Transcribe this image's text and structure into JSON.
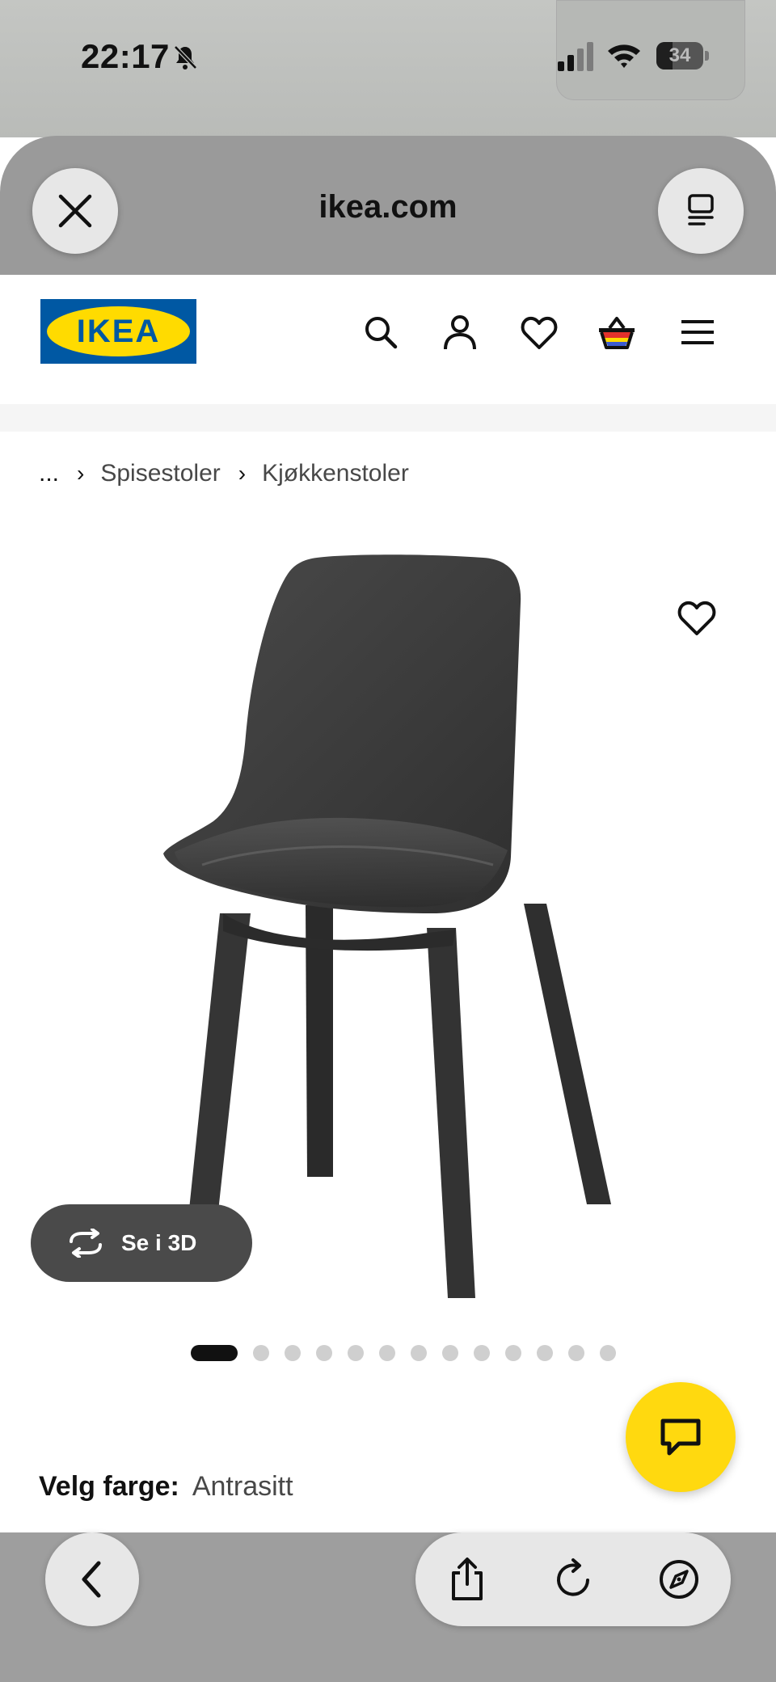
{
  "status_bar": {
    "time": "22:17",
    "battery": "34",
    "battery_level": 0.34,
    "icons": [
      "bell-slash-icon",
      "signal-icon",
      "wifi-icon",
      "battery-icon"
    ]
  },
  "browser": {
    "url": "ikea.com",
    "close_icon": "close-icon",
    "reader_icon": "reader-mode-icon"
  },
  "header": {
    "logo_text": "IKEA",
    "icons": [
      "search-icon",
      "user-icon",
      "heart-icon",
      "basket-icon",
      "menu-icon"
    ]
  },
  "breadcrumb": {
    "ellipsis": "...",
    "items": [
      "Spisestoler",
      "Kjøkkenstoler"
    ]
  },
  "product": {
    "image_alt": "dark grey dining chair",
    "view_3d_label": "Se i 3D",
    "gallery_count": 13,
    "gallery_active": 1,
    "color_label": "Velg farge:",
    "color_value": "Antrasitt"
  },
  "colors": {
    "ikea_blue": "#0058a3",
    "ikea_yellow": "#ffdb00",
    "chat_yellow": "#ffd90f"
  },
  "toolbar": {
    "icons": [
      "back-icon",
      "share-icon",
      "reload-icon",
      "compass-icon"
    ]
  }
}
